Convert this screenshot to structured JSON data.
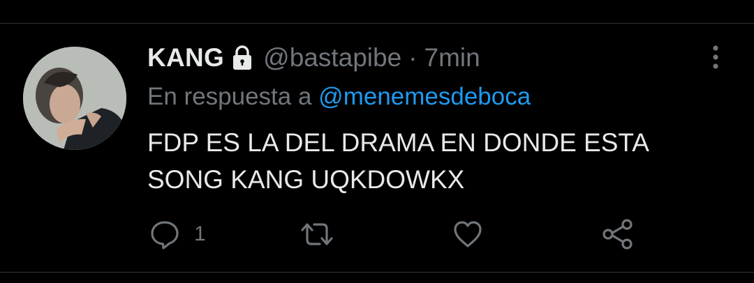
{
  "tweet": {
    "display_name": "KANG",
    "handle": "@bastapibe",
    "separator": "·",
    "time": "7min",
    "reply_prefix": "En respuesta a",
    "reply_mention": "@menemesdeboca",
    "text_line1": "FDP ES LA DEL DRAMA EN DONDE ESTA",
    "text_line2": "SONG KANG UQKDOWKX"
  },
  "actions": {
    "reply_count": "1",
    "retweet_count": "",
    "like_count": ""
  },
  "icons": {
    "avatar": "profile-photo",
    "lock": "lock-icon",
    "more": "more-vertical-icon",
    "reply": "comment-bubble-icon",
    "retweet": "retweet-icon",
    "like": "heart-icon",
    "share": "share-icon"
  },
  "colors": {
    "background": "#000000",
    "text_primary": "#e7e9ea",
    "text_secondary": "#71767b",
    "link": "#1d9bf0",
    "divider": "#2f3336"
  }
}
